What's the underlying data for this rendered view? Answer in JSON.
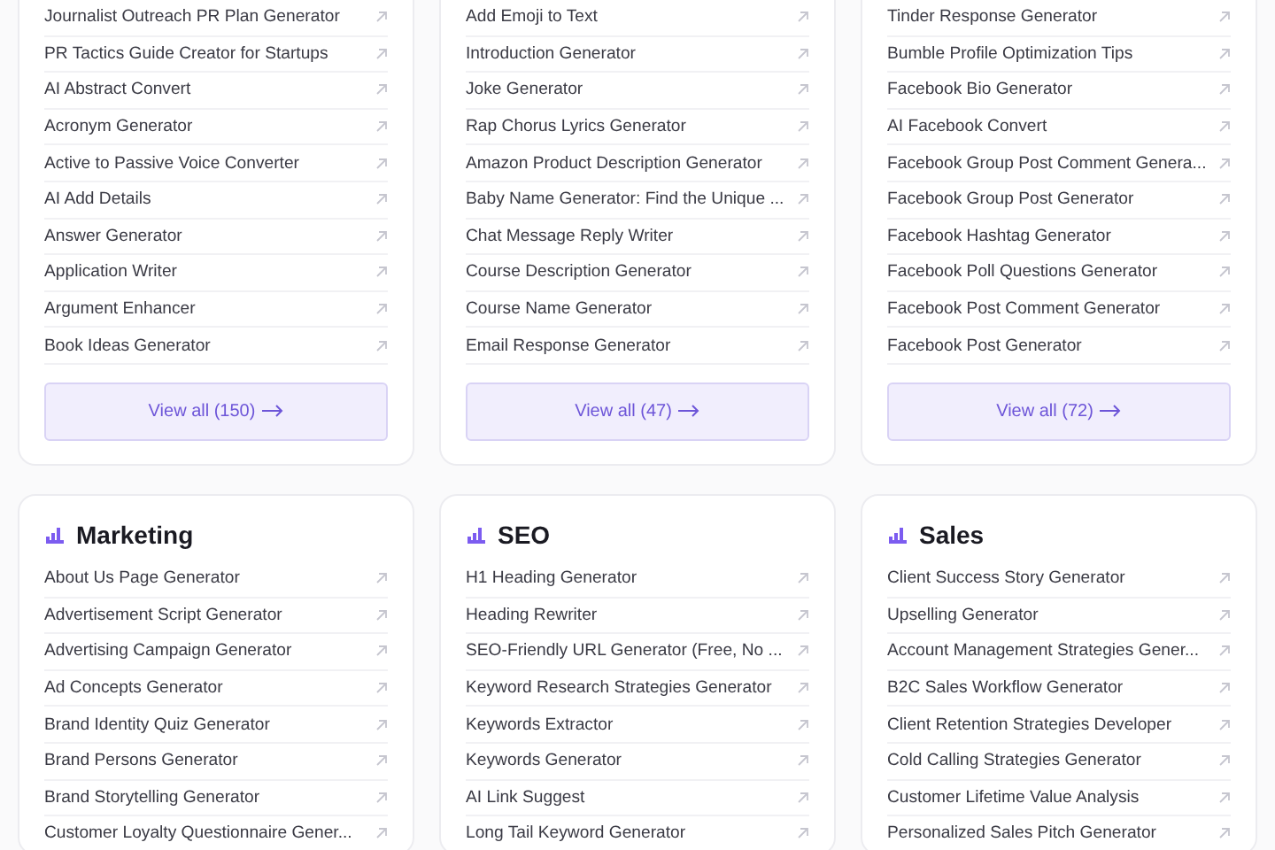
{
  "sections": [
    {
      "items": [
        "Journalist Outreach PR Plan Generator",
        "PR Tactics Guide Creator for Startups",
        "AI Abstract Convert",
        "Acronym Generator",
        "Active to Passive Voice Converter",
        "AI Add Details",
        "Answer Generator",
        "Application Writer",
        "Argument Enhancer",
        "Book Ideas Generator"
      ],
      "view_all": "View all (150)"
    },
    {
      "items": [
        "Add Emoji to Text",
        "Introduction Generator",
        "Joke Generator",
        "Rap Chorus Lyrics Generator",
        "Amazon Product Description Generator",
        "Baby Name Generator: Find the Unique ...",
        "Chat Message Reply Writer",
        "Course Description Generator",
        "Course Name Generator",
        "Email Response Generator"
      ],
      "view_all": "View all (47)"
    },
    {
      "items": [
        "Tinder Response Generator",
        "Bumble Profile Optimization Tips",
        "Facebook Bio Generator",
        "AI Facebook Convert",
        "Facebook Group Post Comment Genera...",
        "Facebook Group Post Generator",
        "Facebook Hashtag Generator",
        "Facebook Poll Questions Generator",
        "Facebook Post Comment Generator",
        "Facebook Post Generator"
      ],
      "view_all": "View all (72)"
    },
    {
      "title": "Marketing",
      "items": [
        "About Us Page Generator",
        "Advertisement Script Generator",
        "Advertising Campaign Generator",
        "Ad Concepts Generator",
        "Brand Identity Quiz Generator",
        "Brand Persons Generator",
        "Brand Storytelling Generator",
        "Customer Loyalty Questionnaire Gener..."
      ]
    },
    {
      "title": "SEO",
      "items": [
        "H1 Heading Generator",
        "Heading Rewriter",
        "SEO-Friendly URL Generator (Free, No ...",
        "Keyword Research Strategies Generator",
        "Keywords Extractor",
        "Keywords Generator",
        "AI Link Suggest",
        "Long Tail Keyword Generator"
      ]
    },
    {
      "title": "Sales",
      "items": [
        "Client Success Story Generator",
        "Upselling Generator",
        "Account Management Strategies Gener...",
        "B2C Sales Workflow Generator",
        "Client Retention Strategies Developer",
        "Cold Calling Strategies Generator",
        "Customer Lifetime Value Analysis",
        "Personalized Sales Pitch Generator"
      ]
    }
  ]
}
